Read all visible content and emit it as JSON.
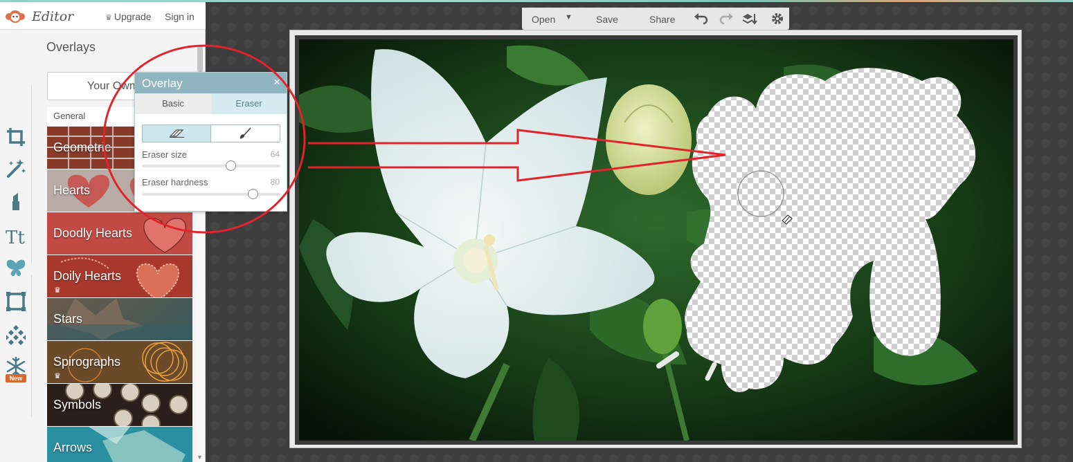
{
  "app": {
    "name": "Editor",
    "upgrade_label": "Upgrade",
    "signin_label": "Sign in"
  },
  "sidebar": {
    "title": "Overlays",
    "your_own_label": "Your Own",
    "category_label": "General",
    "tools": [
      {
        "name": "crop-tool-icon"
      },
      {
        "name": "magic-wand-tool-icon"
      },
      {
        "name": "lipstick-tool-icon"
      },
      {
        "name": "text-tool-icon"
      },
      {
        "name": "butterfly-overlay-tool-icon"
      },
      {
        "name": "frame-tool-icon"
      },
      {
        "name": "texture-tool-icon"
      },
      {
        "name": "snowflake-seasonal-tool-icon"
      }
    ],
    "new_badge": "New",
    "items": [
      {
        "label": "Geometric",
        "premium": false
      },
      {
        "label": "Hearts",
        "premium": false
      },
      {
        "label": "Doodly Hearts",
        "premium": false
      },
      {
        "label": "Doily Hearts",
        "premium": true
      },
      {
        "label": "Stars",
        "premium": false
      },
      {
        "label": "Spirographs",
        "premium": true
      },
      {
        "label": "Symbols",
        "premium": false
      },
      {
        "label": "Arrows",
        "premium": false
      }
    ]
  },
  "toolbar": {
    "open_label": "Open",
    "save_label": "Save",
    "share_label": "Share"
  },
  "overlay_dialog": {
    "title": "Overlay",
    "close_symbol": "×",
    "tabs": [
      {
        "label": "Basic",
        "active": false
      },
      {
        "label": "Eraser",
        "active": true
      }
    ],
    "mode": "erase",
    "eraser_size_label": "Eraser size",
    "eraser_size_value": 64,
    "eraser_hardness_label": "Eraser hardness",
    "eraser_hardness_value": 80,
    "slider_max": 100
  },
  "colors": {
    "accent": "#8fb5c0",
    "active_tab": "#d5ebf0",
    "annotation_red": "#e3232c",
    "new_badge": "#d8692d"
  }
}
